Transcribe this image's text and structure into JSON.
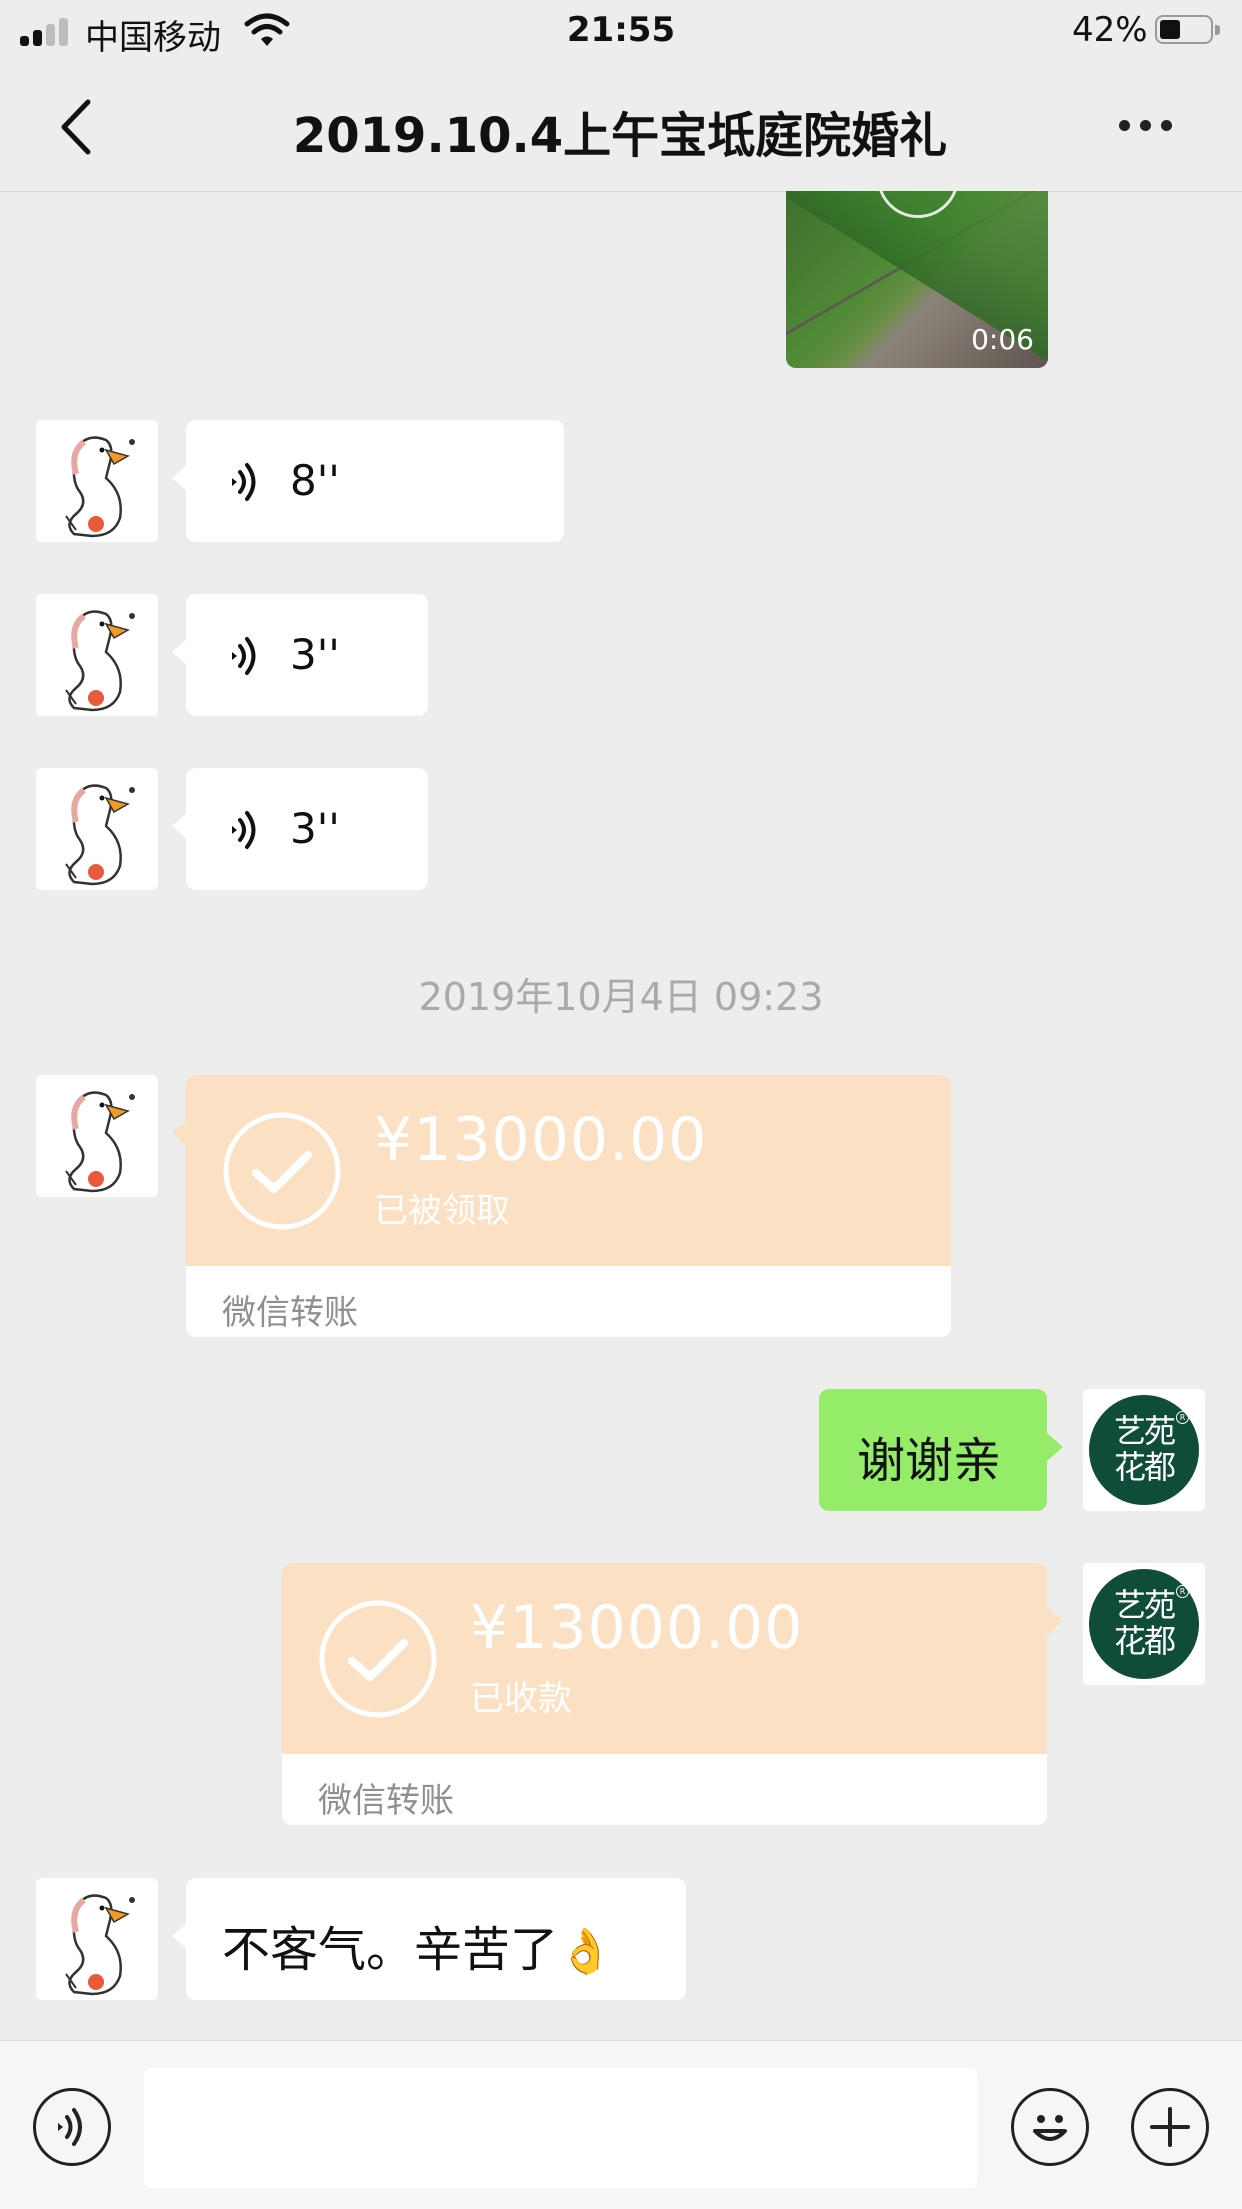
{
  "status_bar": {
    "carrier": "中国移动",
    "time": "21:55",
    "battery_percent_label": "42%",
    "battery_level": 0.42
  },
  "header": {
    "title": "2019.10.4上午宝坻庭院婚礼"
  },
  "video": {
    "duration": "0:06"
  },
  "voice_messages": [
    {
      "duration": "8''"
    },
    {
      "duration": "3''"
    },
    {
      "duration": "3''"
    }
  ],
  "timestamp": "2019年10月4日 09:23",
  "transfers": [
    {
      "amount": "¥13000.00",
      "status": "已被领取",
      "footer": "微信转账"
    },
    {
      "amount": "¥13000.00",
      "status": "已收款",
      "footer": "微信转账"
    }
  ],
  "messages": {
    "outgoing_thanks": "谢谢亲",
    "incoming_reply": "不客气。辛苦了",
    "incoming_reply_emoji": "👌"
  },
  "brand_avatar": {
    "line1": "艺苑",
    "line2": "花都"
  },
  "input": {
    "value": ""
  },
  "colors": {
    "background": "#ededed",
    "outgoing_bubble": "#95ec69",
    "transfer_card": "#fce0c4",
    "brand_green": "#0f4d3a"
  },
  "icons": {
    "back": "chevron-left-icon",
    "more": "ellipsis-icon",
    "voice": "voice-wave-icon",
    "check": "check-circle-icon",
    "emoji": "smiley-icon",
    "plus": "plus-circle-icon"
  }
}
